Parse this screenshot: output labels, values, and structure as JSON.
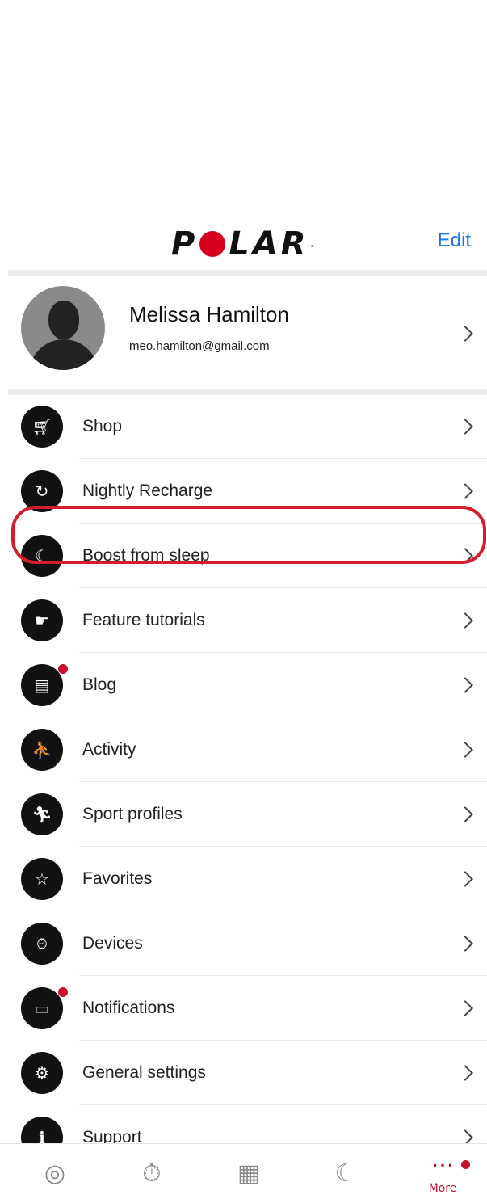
{
  "header": {
    "logo_text": "POLAR",
    "edit_label": "Edit"
  },
  "profile": {
    "name": "Melissa Hamilton",
    "email": "meo.hamilton@gmail.com"
  },
  "menu": [
    {
      "label": "Shop",
      "icon": "cart-icon",
      "badge": false
    },
    {
      "label": "Nightly Recharge",
      "icon": "recharge-icon",
      "badge": false
    },
    {
      "label": "Boost from sleep",
      "icon": "moon-sparkle-icon",
      "badge": false,
      "highlighted": true
    },
    {
      "label": "Feature tutorials",
      "icon": "tutorial-icon",
      "badge": false
    },
    {
      "label": "Blog",
      "icon": "chat-icon",
      "badge": true
    },
    {
      "label": "Activity",
      "icon": "activity-icon",
      "badge": false
    },
    {
      "label": "Sport profiles",
      "icon": "running-icon",
      "badge": false
    },
    {
      "label": "Favorites",
      "icon": "star-icon",
      "badge": false
    },
    {
      "label": "Devices",
      "icon": "watch-icon",
      "badge": false
    },
    {
      "label": "Notifications",
      "icon": "notification-icon",
      "badge": true
    },
    {
      "label": "General settings",
      "icon": "gear-icon",
      "badge": false
    },
    {
      "label": "Support",
      "icon": "info-icon",
      "badge": false
    }
  ],
  "tabbar": {
    "items": [
      {
        "icon": "activity-rings-icon",
        "label": ""
      },
      {
        "icon": "stopwatch-icon",
        "label": ""
      },
      {
        "icon": "calendar-icon",
        "label": ""
      },
      {
        "icon": "moon-icon",
        "label": ""
      },
      {
        "icon": "more-icon",
        "label": "More",
        "active": true
      }
    ]
  },
  "colors": {
    "accent_red": "#c8102e",
    "link_blue": "#1a73e8",
    "icon_black": "#111111"
  }
}
